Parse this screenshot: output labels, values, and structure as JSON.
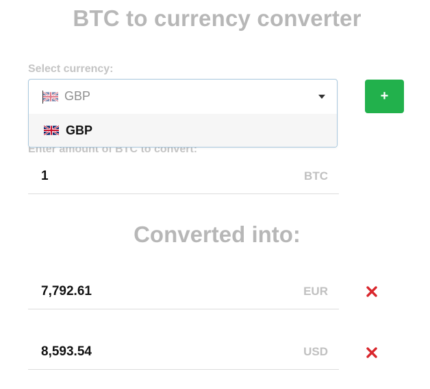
{
  "header": {
    "title": "BTC to currency converter"
  },
  "currency_select": {
    "label": "Select currency:",
    "selected_value": "GBP",
    "selected_flag_icon": "uk-flag-icon",
    "options": [
      {
        "label": "GBP",
        "icon": "uk-flag-icon"
      }
    ]
  },
  "add_button": {
    "label": "+",
    "color": "#22b14c"
  },
  "amount": {
    "label": "Enter amount of BTC to convert:",
    "value": "1",
    "unit": "BTC"
  },
  "converted": {
    "heading": "Converted into:",
    "rows": [
      {
        "value": "7,792.61",
        "currency": "EUR",
        "remove_icon": "close-icon"
      },
      {
        "value": "8,593.54",
        "currency": "USD",
        "remove_icon": "close-icon"
      }
    ]
  },
  "colors": {
    "remove": "#d9262c",
    "muted_text": "#b7b7b7",
    "focus_border": "#a9c8de"
  }
}
